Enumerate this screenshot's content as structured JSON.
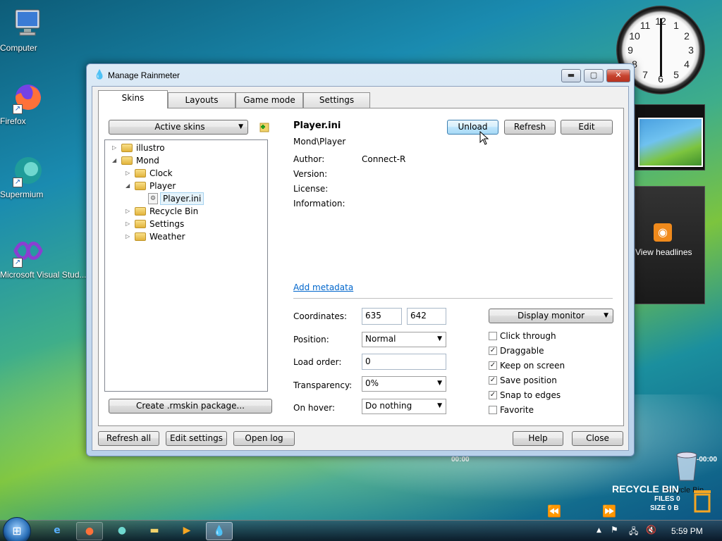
{
  "desktop": {
    "icons": [
      {
        "label": "Computer"
      },
      {
        "label": "Firefox"
      },
      {
        "label": "Supermium"
      },
      {
        "label": "Microsoft Visual Stud..."
      }
    ],
    "feed_gadget_text": "View headlines",
    "clock_numbers": [
      "12",
      "1",
      "2",
      "3",
      "4",
      "5",
      "6",
      "7",
      "8",
      "9",
      "10",
      "11"
    ],
    "overlay": {
      "player_time_left": "00:00",
      "player_time_right": "-00:00",
      "recycle_bin_title": "RECYCLE BIN",
      "recycle_bin_files": "FILES 0",
      "recycle_bin_size": "SIZE 0 B",
      "recycle_bin_label": "Recycle Bin"
    }
  },
  "window": {
    "title": "Manage Rainmeter",
    "tabs": [
      {
        "label": "Skins"
      },
      {
        "label": "Layouts"
      },
      {
        "label": "Game mode"
      },
      {
        "label": "Settings"
      }
    ],
    "active_skins_label": "Active skins",
    "tree": [
      {
        "label": "illustro"
      },
      {
        "label": "Mond"
      },
      {
        "label": "Clock"
      },
      {
        "label": "Player"
      },
      {
        "label": "Player.ini"
      },
      {
        "label": "Recycle Bin"
      },
      {
        "label": "Settings"
      },
      {
        "label": "Weather"
      }
    ],
    "create_package_label": "Create .rmskin package...",
    "skin": {
      "name": "Player.ini",
      "path": "Mond\\Player",
      "author_label": "Author:",
      "author_value": "Connect-R",
      "version_label": "Version:",
      "license_label": "License:",
      "information_label": "Information:",
      "add_metadata_label": "Add metadata"
    },
    "actions": {
      "unload": "Unload",
      "refresh": "Refresh",
      "edit": "Edit"
    },
    "settings": {
      "coordinates_label": "Coordinates:",
      "coord_x": "635",
      "coord_y": "642",
      "position_label": "Position:",
      "position_value": "Normal",
      "load_order_label": "Load order:",
      "load_order_value": "0",
      "transparency_label": "Transparency:",
      "transparency_value": "0%",
      "on_hover_label": "On hover:",
      "on_hover_value": "Do nothing",
      "display_monitor_label": "Display monitor"
    },
    "checkboxes": [
      {
        "label": "Click through",
        "checked": false
      },
      {
        "label": "Draggable",
        "checked": true
      },
      {
        "label": "Keep on screen",
        "checked": true
      },
      {
        "label": "Save position",
        "checked": true
      },
      {
        "label": "Snap to edges",
        "checked": true
      },
      {
        "label": "Favorite",
        "checked": false
      }
    ],
    "footer": {
      "refresh_all": "Refresh all",
      "edit_settings": "Edit settings",
      "open_log": "Open log",
      "help": "Help",
      "close": "Close"
    }
  },
  "taskbar": {
    "time": "5:59 PM"
  }
}
